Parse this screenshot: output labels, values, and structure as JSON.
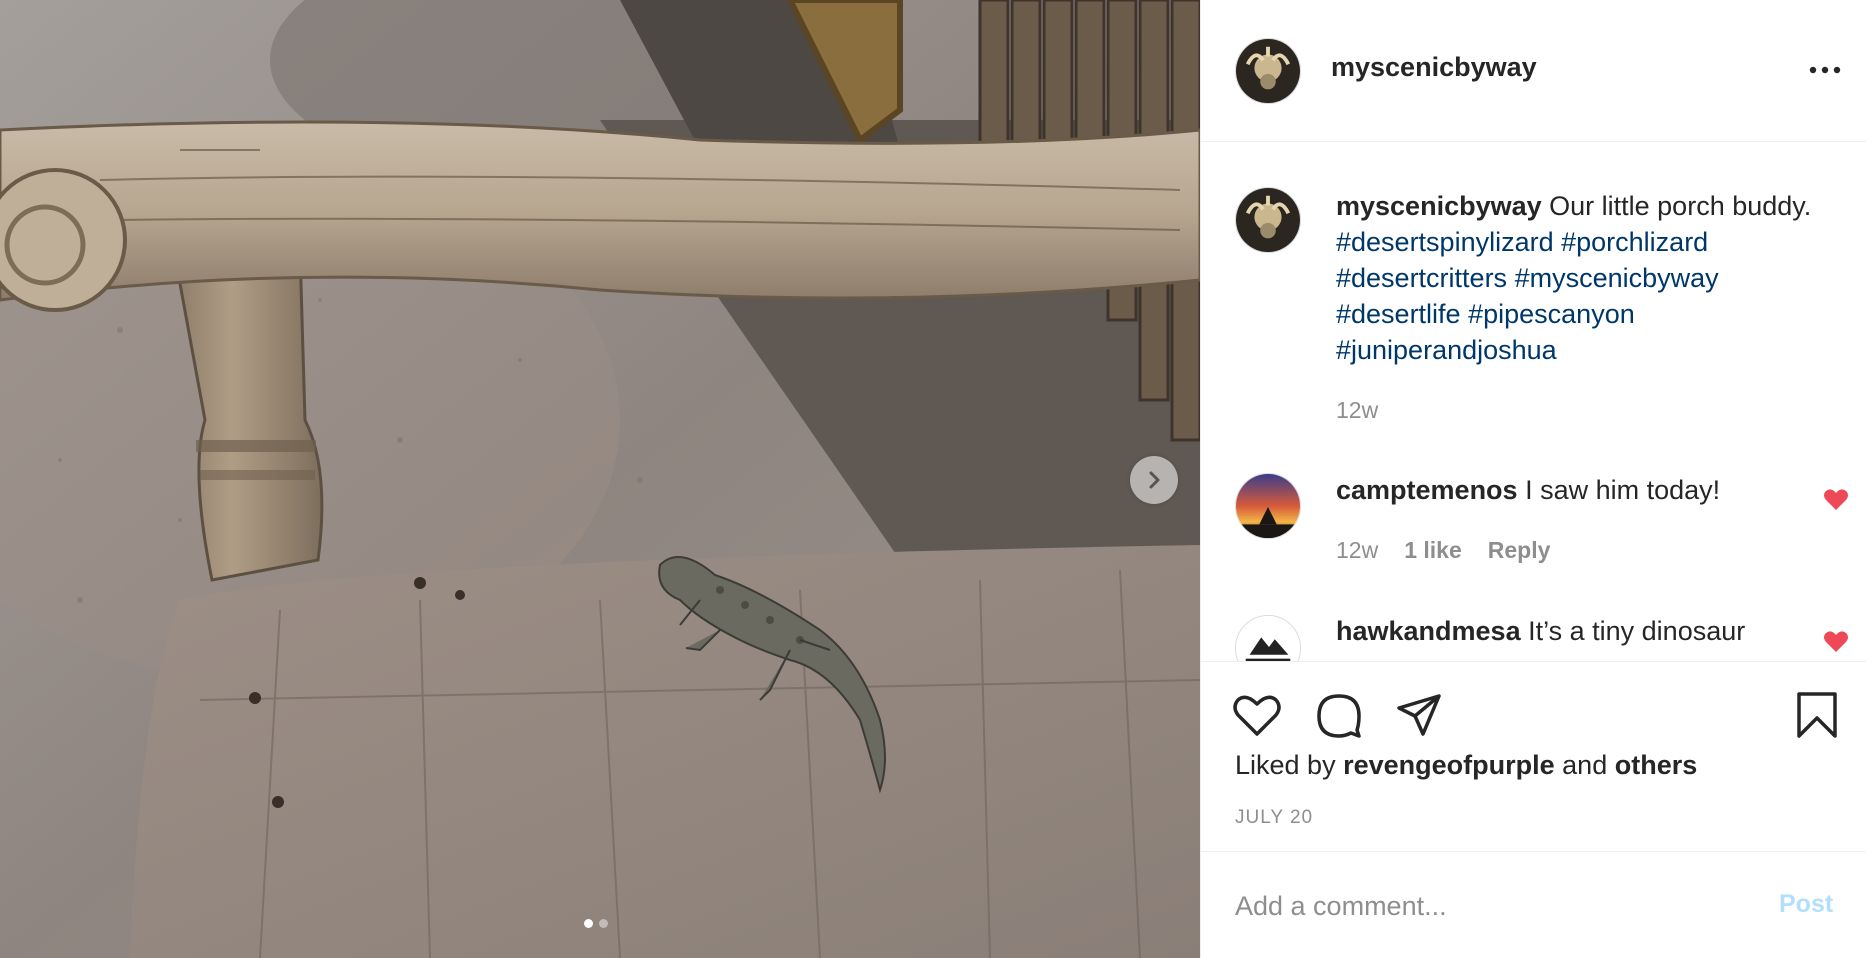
{
  "post": {
    "username": "myscenicbyway",
    "caption": {
      "username": "myscenicbyway",
      "text": "Our little porch buddy.",
      "hashtags": [
        "#desertspinylizard",
        "#porchlizard",
        "#desertcritters",
        "#myscenicbyway",
        "#desertlife",
        "#pipescanyon",
        "#juniperandjoshua"
      ],
      "time": "12w"
    },
    "comments": [
      {
        "username": "camptemenos",
        "text": "I saw him today!",
        "time": "12w",
        "likes": "1 like",
        "reply": "Reply",
        "liked": true
      },
      {
        "username": "hawkandmesa",
        "text": "It’s a tiny dinosaur",
        "liked": true
      }
    ],
    "liked_by": {
      "prefix": "Liked by",
      "user": "revengeofpurple",
      "conj": "and",
      "others": "others"
    },
    "date": "JULY 20",
    "add_comment": {
      "placeholder": "Add a comment...",
      "post_label": "Post"
    },
    "carousel": {
      "count": 2,
      "active": 0
    },
    "icons": [
      "more-icon",
      "heart-icon",
      "comment-icon",
      "share-icon",
      "bookmark-icon",
      "chevron-right-icon"
    ],
    "colors": {
      "hashtag": "#00376b",
      "like_red": "#ed4956",
      "muted": "#8e8e8e",
      "post_disabled": "#b2dffc"
    }
  }
}
